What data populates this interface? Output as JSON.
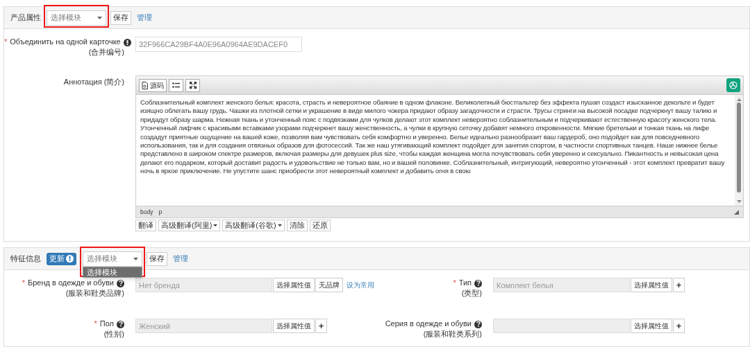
{
  "product_section": {
    "title": "产品属性",
    "template_select": {
      "value": "选择模块",
      "highlighted": true
    },
    "save": "保存",
    "manage": "管理",
    "merge_field": {
      "required_mark": "*",
      "label": "Объединить на одной карточке",
      "sub": "(合并编号)",
      "value": "32F966CA29BF4A0E96A0964AE9DACEF0"
    },
    "annotation": {
      "label": "Аннотация (简介)",
      "source_button": "源码",
      "text": "Соблазнительный комплект женского белья: красота, страсть и невероятное обаяние в одном флаконе. Великолепный бюстгальтер без эффекта пушап создаст изысканное декольте и будет изящно облегать вашу грудь. Чашки из плотной сетки и украшение в виде милого чокера придают образу загадочности и страсти. Трусы стринги на высокой посадке подчеркнут вашу талию и придадут образу шарма. Нежная ткань и утонченный пояс с подвязками для чулков делают этот комплект невероятно соблазнительным и подчеркивают естественную красоту женского тела. Утонченный лифчик с красивыми вставками узорами подчеркнет вашу женственность, а чулки в крупную сеточку добавят немного откровенности. Мягкие бретельки и тонкая ткань на лифе создадут приятные ощущение на вашей коже, позволяя вам чувствовать себя комфортно и уверенно. Белье идеально разнообразит ваш гардероб, оно подойдет как для повседневного использования, так и для создания отвязных образов для фотосессий. Так же наш утягивающий комплект подойдет для занятия спортом, в частности спортивных танцев. Наше нижнее белье представлено в широком спектре размеров, включая размеры для девушек plus size, чтобы каждая женщина могла почувствовать себя уверенно и сексуально. Пикантность и невысокая цена делают его подарком, который доставит радость и удовольствие не только вам, но и вашей половинке. Соблазнительный, интригующий, невероятно утонченный - этот комплект превратит вашу ночь в яркое приключение. Не упустите шанс приобрести этот невероятный комплект и добавить огня в свою",
      "path": [
        "body",
        "p"
      ],
      "actions": [
        {
          "label": "翻译",
          "dropdown": false
        },
        {
          "label": "高级翻译(阿里)",
          "dropdown": true
        },
        {
          "label": "高级翻译(谷歌)",
          "dropdown": true
        },
        {
          "label": "清除",
          "dropdown": false
        },
        {
          "label": "还原",
          "dropdown": false
        }
      ]
    }
  },
  "feature_section": {
    "title": "特征信息",
    "update_badge": "更新",
    "template_select": {
      "value": "选择模块",
      "highlighted": true,
      "expanded": true,
      "options": [
        {
          "label": "选择模块",
          "selected": true
        }
      ]
    },
    "save": "保存",
    "manage": "管理",
    "fields": [
      {
        "required_mark": "*",
        "label": "Бренд в одежде и обуви",
        "sub": "(服装和鞋类品牌)",
        "value": "Нет бренда",
        "buttons": [
          "选择属性值",
          "无品牌"
        ],
        "link": "设为常用"
      },
      {
        "required_mark": "*",
        "label": "Тип",
        "sub": "(类型)",
        "value": "Комплект белья",
        "buttons": [
          "选择属性值",
          "+"
        ]
      },
      {
        "required_mark": "*",
        "label": "Пол",
        "sub": "(性别)",
        "value": "Женский",
        "buttons": [
          "选择属性值",
          "+"
        ]
      },
      {
        "label": "Серия в одежде и обуви",
        "sub": "(服装和鞋类系列)",
        "buttons": [
          "选择属性值",
          "+"
        ]
      }
    ]
  }
}
